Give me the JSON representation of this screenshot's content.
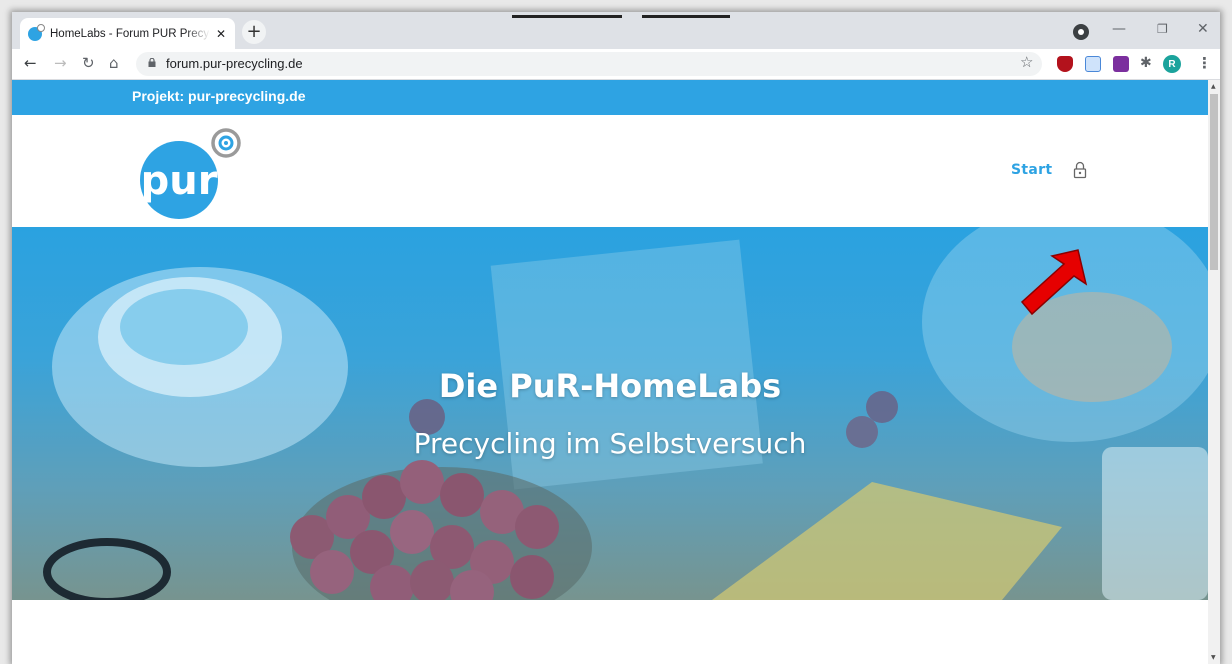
{
  "browser": {
    "tab_title": "HomeLabs - Forum PUR Precycling",
    "tab_close": "✕",
    "new_tab": "+",
    "url": "forum.pur-precycling.de",
    "avatar_letter": "R"
  },
  "site": {
    "project_label": "Projekt: pur-precycling.de",
    "nav_start": "Start",
    "hero_title": "Die PuR-HomeLabs",
    "hero_subtitle": "Precycling im Selbstversuch"
  },
  "colors": {
    "brand_blue": "#2ea3e3",
    "arrow_red": "#e60000"
  },
  "icons": [
    "back-icon",
    "forward-icon",
    "reload-icon",
    "home-icon",
    "lock-icon",
    "star-icon",
    "puzzle-icon",
    "menu-icon",
    "login-lock-icon",
    "red-arrow"
  ]
}
